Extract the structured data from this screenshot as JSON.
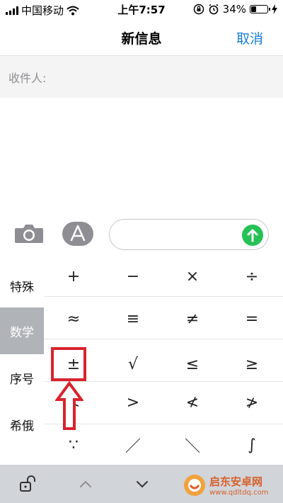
{
  "status_bar": {
    "carrier": "中国移动",
    "time": "上午7:57",
    "battery_percent": "34%",
    "battery_level": 0.34
  },
  "nav": {
    "title": "新信息",
    "cancel_label": "取消"
  },
  "recipient": {
    "label": "收件人:"
  },
  "compose": {
    "input_value": ""
  },
  "keyboard": {
    "categories": [
      "特殊",
      "数学",
      "序号",
      "希俄"
    ],
    "active_category": "数学",
    "rows": [
      [
        "+",
        "−",
        "×",
        "÷"
      ],
      [
        "≈",
        "≡",
        "≠",
        "="
      ],
      [
        "±",
        "√",
        "≤",
        "≥"
      ],
      [
        "<",
        ">",
        "≮",
        "≯"
      ],
      [
        "∵",
        "／",
        "＼",
        "∫"
      ]
    ]
  },
  "watermark": {
    "title": "启东安卓网",
    "url": "www.qdltdq.com"
  },
  "colors": {
    "accent": "#1a7fd8",
    "send": "#25c155",
    "highlight": "#d9232d",
    "keyboard_bar": "#d1d4d9"
  }
}
